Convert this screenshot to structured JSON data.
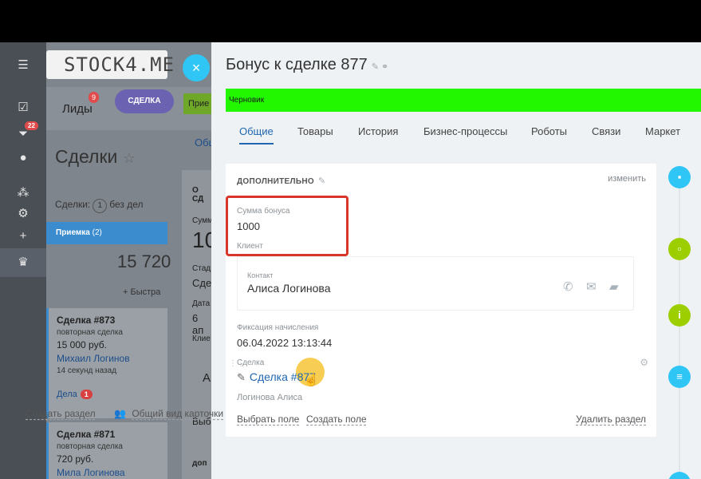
{
  "background_app": {
    "logo": "STOCK4.ME",
    "rail_badge": "22",
    "leads_label": "Лиды",
    "leads_badge": "9",
    "deal_pill": "СДЕЛКА",
    "green_pill": "Прие",
    "deals_title": "Сделки",
    "deals_meta_prefix": "Сделки:",
    "deals_meta_count": "1",
    "deals_meta_suffix": "без дел",
    "stage_name": "Приемка",
    "stage_count": "(2)",
    "stage_sum": "15 720",
    "quick_add": "+ Быстра",
    "mid_tab": "Общ",
    "mid_texts": [
      "О СД",
      "Сумм",
      "10",
      "Стад",
      "Сде",
      "Дата",
      "6 ап",
      "Клие",
      "А",
      "Выб",
      "доп"
    ],
    "cards": [
      {
        "title": "Сделка #873",
        "sub": "повторная сделка",
        "price": "15 000 руб.",
        "name": "Михаил Логинов",
        "time": "14 секунд назад",
        "deals": "Дела",
        "deals_count": "1"
      },
      {
        "title": "Сделка #871",
        "sub": "повторная сделка",
        "price": "720 руб.",
        "name": "Мила Логинова"
      }
    ]
  },
  "panel": {
    "close_icon": "×",
    "title": "Бонус к сделке 877",
    "status": "Черновик",
    "status_color": "#22f700",
    "tabs": [
      "Общие",
      "Товары",
      "История",
      "Бизнес-процессы",
      "Роботы",
      "Связи",
      "Маркет"
    ],
    "active_tab": "Общие",
    "section": {
      "title": "ДОПОЛНИТЕЛЬНО",
      "change_label": "изменить",
      "bonus_label": "Сумма бонуса",
      "bonus_value": "1000",
      "client_label": "Клиент",
      "contact_label": "Контакт",
      "contact_name": "Алиса Логинова",
      "fix_label": "Фиксация начисления",
      "fix_value": "06.04.2022 13:13:44",
      "deal_label": "Сделка",
      "deal_link": "Сделка #877",
      "deal_owner": "Логинова Алиса",
      "select_field": "Выбрать поле",
      "create_field": "Создать поле",
      "delete_section": "Удалить раздел"
    },
    "bottom": {
      "create_section": "Создать раздел",
      "card_view": "Общий вид карточки"
    }
  },
  "timeline": [
    {
      "icon": "chat-icon",
      "glyph": "▪",
      "color": "#2fc6f6"
    },
    {
      "icon": "comment-icon",
      "glyph": "▫",
      "color": "#9dcf00"
    },
    {
      "icon": "info-icon",
      "glyph": "i",
      "color": "#9dcf00"
    },
    {
      "icon": "message-icon",
      "glyph": "≡",
      "color": "#2fc6f6"
    }
  ]
}
